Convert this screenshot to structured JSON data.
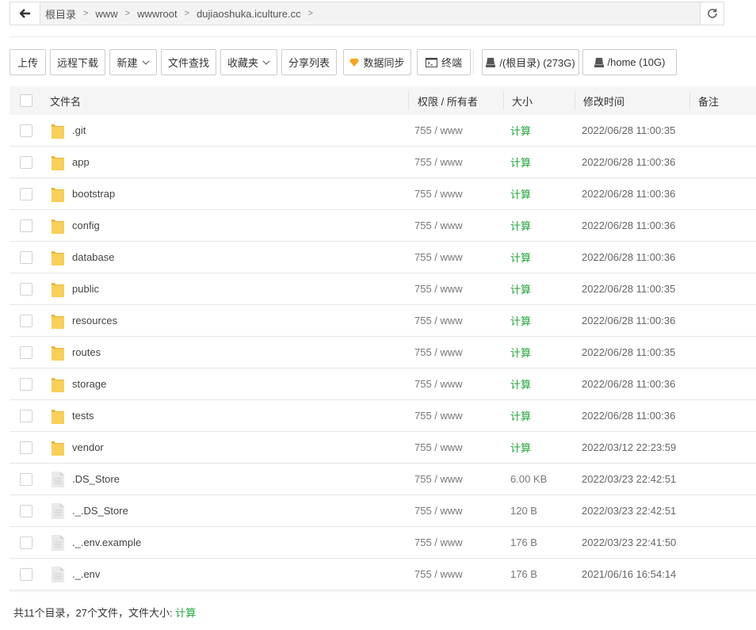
{
  "breadcrumb": [
    "根目录",
    "www",
    "wwwroot",
    "dujiaoshuka.iculture.cc"
  ],
  "toolbar": {
    "upload": "上传",
    "remote_download": "远程下载",
    "new": "新建",
    "find": "文件查找",
    "favorites": "收藏夹",
    "share_list": "分享列表",
    "sync": "数据同步",
    "terminal": "终端",
    "disk_root": "/(根目录) (273G)",
    "disk_home": "/home (10G)"
  },
  "columns": {
    "name": "文件名",
    "perm": "权限 / 所有者",
    "size": "大小",
    "mtime": "修改时间",
    "note": "备注"
  },
  "colors": {
    "accent": "#20a53a",
    "folder": "#f7c94b",
    "sync_icon": "#f5a623"
  },
  "rows": [
    {
      "type": "folder",
      "name": ".git",
      "perm": "755 / www",
      "size": "计算",
      "mtime": "2022/06/28 11:00:35"
    },
    {
      "type": "folder",
      "name": "app",
      "perm": "755 / www",
      "size": "计算",
      "mtime": "2022/06/28 11:00:36"
    },
    {
      "type": "folder",
      "name": "bootstrap",
      "perm": "755 / www",
      "size": "计算",
      "mtime": "2022/06/28 11:00:36"
    },
    {
      "type": "folder",
      "name": "config",
      "perm": "755 / www",
      "size": "计算",
      "mtime": "2022/06/28 11:00:36"
    },
    {
      "type": "folder",
      "name": "database",
      "perm": "755 / www",
      "size": "计算",
      "mtime": "2022/06/28 11:00:36"
    },
    {
      "type": "folder",
      "name": "public",
      "perm": "755 / www",
      "size": "计算",
      "mtime": "2022/06/28 11:00:35"
    },
    {
      "type": "folder",
      "name": "resources",
      "perm": "755 / www",
      "size": "计算",
      "mtime": "2022/06/28 11:00:36"
    },
    {
      "type": "folder",
      "name": "routes",
      "perm": "755 / www",
      "size": "计算",
      "mtime": "2022/06/28 11:00:35"
    },
    {
      "type": "folder",
      "name": "storage",
      "perm": "755 / www",
      "size": "计算",
      "mtime": "2022/06/28 11:00:36"
    },
    {
      "type": "folder",
      "name": "tests",
      "perm": "755 / www",
      "size": "计算",
      "mtime": "2022/06/28 11:00:36"
    },
    {
      "type": "folder",
      "name": "vendor",
      "perm": "755 / www",
      "size": "计算",
      "mtime": "2022/03/12 22:23:59"
    },
    {
      "type": "file",
      "name": ".DS_Store",
      "perm": "755 / www",
      "size": "6.00 KB",
      "mtime": "2022/03/23 22:42:51"
    },
    {
      "type": "file",
      "name": "._.DS_Store",
      "perm": "755 / www",
      "size": "120 B",
      "mtime": "2022/03/23 22:42:51"
    },
    {
      "type": "file",
      "name": "._.env.example",
      "perm": "755 / www",
      "size": "176 B",
      "mtime": "2022/03/23 22:41:50"
    },
    {
      "type": "file",
      "name": "._.env",
      "perm": "755 / www",
      "size": "176 B",
      "mtime": "2021/06/16 16:54:14"
    }
  ],
  "footer": {
    "summary": "共11个目录，27个文件，文件大小: ",
    "calc": "计算"
  }
}
